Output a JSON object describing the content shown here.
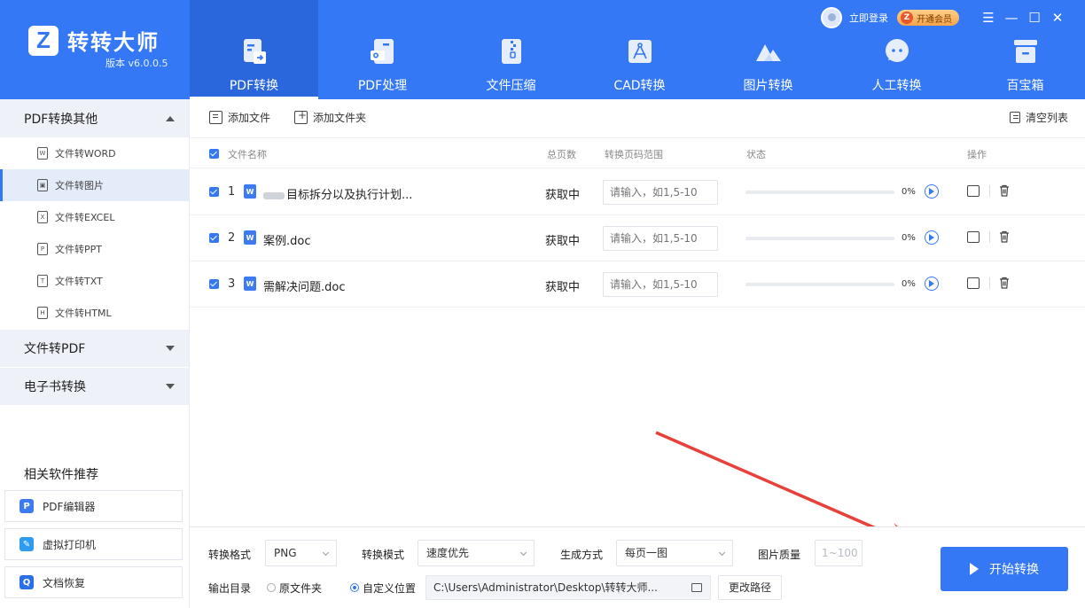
{
  "app": {
    "name": "转转大师",
    "version": "版本 v6.0.0.5",
    "logo_letter": "Z",
    "login_label": "立即登录",
    "vip_label": "开通会员",
    "accent": "#3478f6"
  },
  "nav": [
    {
      "label": "PDF转换",
      "icon": "pdf-convert-icon",
      "active": true
    },
    {
      "label": "PDF处理",
      "icon": "pdf-process-icon",
      "active": false
    },
    {
      "label": "文件压缩",
      "icon": "file-compress-icon",
      "active": false
    },
    {
      "label": "CAD转换",
      "icon": "cad-convert-icon",
      "active": false
    },
    {
      "label": "图片转换",
      "icon": "image-convert-icon",
      "active": false
    },
    {
      "label": "人工转换",
      "icon": "manual-convert-icon",
      "active": false
    },
    {
      "label": "百宝箱",
      "icon": "toolbox-icon",
      "active": false
    }
  ],
  "sidebar": {
    "sections": [
      {
        "label": "PDF转换其他",
        "expanded": true
      },
      {
        "label": "文件转PDF",
        "expanded": false
      },
      {
        "label": "电子书转换",
        "expanded": false
      }
    ],
    "items": [
      {
        "label": "文件转WORD",
        "glyph": "W"
      },
      {
        "label": "文件转图片",
        "glyph": "▣"
      },
      {
        "label": "文件转EXCEL",
        "glyph": "X"
      },
      {
        "label": "文件转PPT",
        "glyph": "P"
      },
      {
        "label": "文件转TXT",
        "glyph": "T"
      },
      {
        "label": "文件转HTML",
        "glyph": "H"
      }
    ],
    "active_item": "文件转图片",
    "recommend_title": "相关软件推荐",
    "recommend": [
      {
        "label": "PDF编辑器",
        "glyph": "P",
        "color": "#3d7cf0"
      },
      {
        "label": "虚拟打印机",
        "glyph": "✎",
        "color": "#2f9bf0"
      },
      {
        "label": "文档恢复",
        "glyph": "Q",
        "color": "#2a6fe6"
      }
    ]
  },
  "toolbar": {
    "add_file": "添加文件",
    "add_folder": "添加文件夹",
    "clear_list": "清空列表"
  },
  "table": {
    "headers": {
      "name": "文件名称",
      "pages": "总页数",
      "range": "转换页码范围",
      "status": "状态",
      "ops": "操作"
    },
    "rows": [
      {
        "num": "1",
        "name": "目标拆分以及执行计划...",
        "pages": "获取中",
        "range_placeholder": "请输入，如1,5-10",
        "progress": "0%"
      },
      {
        "num": "2",
        "name": "案例.doc",
        "pages": "获取中",
        "range_placeholder": "请输入，如1,5-10",
        "progress": "0%"
      },
      {
        "num": "3",
        "name": "需解决问题.doc",
        "pages": "获取中",
        "range_placeholder": "请输入，如1,5-10",
        "progress": "0%"
      }
    ]
  },
  "options": {
    "format_label": "转换格式",
    "format_value": "PNG",
    "mode_label": "转换模式",
    "mode_value": "速度优先",
    "gen_label": "生成方式",
    "gen_value": "每页一图",
    "quality_label": "图片质量",
    "quality_placeholder": "1~100",
    "output_label": "输出目录",
    "output_original": "原文件夹",
    "output_custom": "自定义位置",
    "output_path": "C:\\Users\\Administrator\\Desktop\\转转大师...",
    "change_path": "更改路径",
    "start": "开始转换"
  }
}
